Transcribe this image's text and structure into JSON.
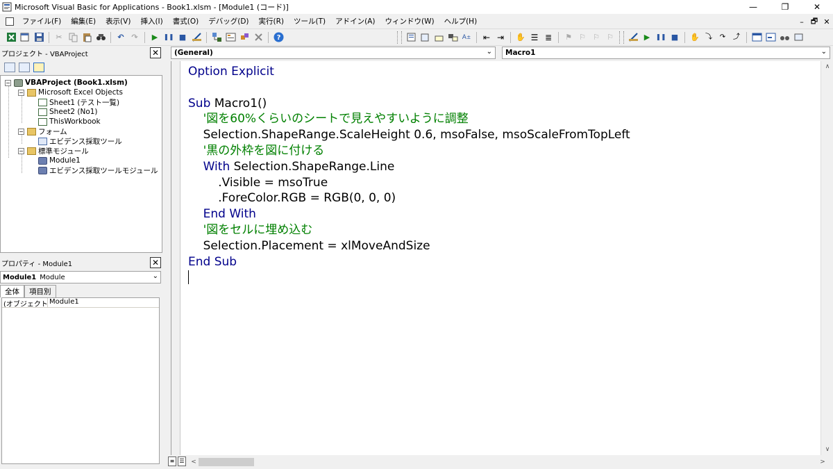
{
  "window": {
    "title": "Microsoft Visual Basic for Applications - Book1.xlsm - [Module1 (コード)]",
    "controls": {
      "minimize": "—",
      "restore": "❐",
      "close": "✕"
    }
  },
  "menubar": {
    "items": [
      "ファイル(F)",
      "編集(E)",
      "表示(V)",
      "挿入(I)",
      "書式(O)",
      "デバッグ(D)",
      "実行(R)",
      "ツール(T)",
      "アドイン(A)",
      "ウィンドウ(W)",
      "ヘルプ(H)"
    ],
    "mdi_controls": {
      "minimize": "–",
      "restore": "🗗",
      "close": "✕"
    }
  },
  "project_explorer": {
    "title": "プロジェクト - VBAProject",
    "close": "✕",
    "root": "VBAProject (Book1.xlsm)",
    "excel_objects_folder": "Microsoft Excel Objects",
    "sheet1": "Sheet1 (テスト一覧)",
    "sheet2": "Sheet2 (No1)",
    "thisworkbook": "ThisWorkbook",
    "forms_folder": "フォーム",
    "form1": "エビデンス採取ツール",
    "modules_folder": "標準モジュール",
    "module1": "Module1",
    "module2": "エビデンス採取ツールモジュール"
  },
  "properties": {
    "title": "プロパティ - Module1",
    "close": "✕",
    "combo_name": "Module1",
    "combo_type": "Module",
    "tabs": [
      "全体",
      "項目別"
    ],
    "rows": [
      {
        "name": "(オブジェクト名)",
        "value": "Module1"
      }
    ]
  },
  "code_window": {
    "object_combo": "(General)",
    "procedure_combo": "Macro1",
    "lines": [
      {
        "indent": "",
        "parts": [
          {
            "t": "Option Explicit",
            "c": "kw"
          }
        ]
      },
      {
        "indent": "",
        "parts": []
      },
      {
        "indent": "",
        "parts": [
          {
            "t": "Sub",
            "c": "kw"
          },
          {
            "t": " Macro1()",
            "c": ""
          }
        ]
      },
      {
        "indent": "    ",
        "parts": [
          {
            "t": "'図を60%くらいのシートで見えやすいように調整",
            "c": "cm"
          }
        ]
      },
      {
        "indent": "    ",
        "parts": [
          {
            "t": "Selection.ShapeRange.ScaleHeight 0.6, msoFalse, msoScaleFromTopLeft",
            "c": ""
          }
        ]
      },
      {
        "indent": "    ",
        "parts": [
          {
            "t": "'黒の外枠を図に付ける",
            "c": "cm"
          }
        ]
      },
      {
        "indent": "    ",
        "parts": [
          {
            "t": "With",
            "c": "kw"
          },
          {
            "t": " Selection.ShapeRange.Line",
            "c": ""
          }
        ]
      },
      {
        "indent": "        ",
        "parts": [
          {
            "t": ".Visible = msoTrue",
            "c": ""
          }
        ]
      },
      {
        "indent": "        ",
        "parts": [
          {
            "t": ".ForeColor.RGB = RGB(0, 0, 0)",
            "c": ""
          }
        ]
      },
      {
        "indent": "    ",
        "parts": [
          {
            "t": "End With",
            "c": "kw"
          }
        ]
      },
      {
        "indent": "    ",
        "parts": [
          {
            "t": "'図をセルに埋め込む",
            "c": "cm"
          }
        ]
      },
      {
        "indent": "    ",
        "parts": [
          {
            "t": "Selection.Placement = xlMoveAndSize",
            "c": ""
          }
        ]
      },
      {
        "indent": "",
        "parts": [
          {
            "t": "End Sub",
            "c": "kw"
          }
        ]
      }
    ]
  },
  "colors": {
    "keyword": "#00008b",
    "comment": "#008000",
    "text": "#000000"
  }
}
